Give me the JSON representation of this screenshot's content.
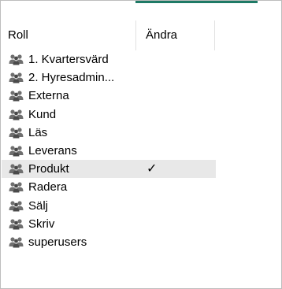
{
  "columns": {
    "roll": "Roll",
    "andra": "Ändra"
  },
  "rows": [
    {
      "label": "1. Kvartersvärd",
      "andra": ""
    },
    {
      "label": "2. Hyresadmin...",
      "andra": ""
    },
    {
      "label": "Externa",
      "andra": ""
    },
    {
      "label": "Kund",
      "andra": ""
    },
    {
      "label": "Läs",
      "andra": ""
    },
    {
      "label": "Leverans",
      "andra": ""
    },
    {
      "label": "Produkt",
      "andra": "✓"
    },
    {
      "label": "Radera",
      "andra": ""
    },
    {
      "label": "Sälj",
      "andra": ""
    },
    {
      "label": "Skriv",
      "andra": ""
    },
    {
      "label": "superusers",
      "andra": ""
    }
  ],
  "icons": {
    "row_icon": "group-icon",
    "check_icon": "checkmark-icon"
  },
  "colors": {
    "accent": "#1f7a66",
    "selected_row": "#e8e8e8",
    "icon_gray": "#6f6f6f"
  }
}
